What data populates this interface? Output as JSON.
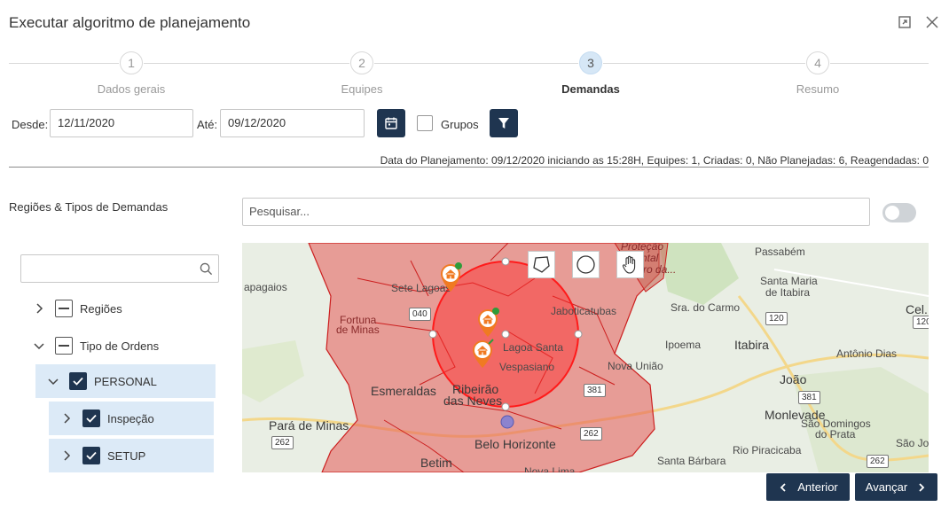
{
  "dialog": {
    "title": "Executar algoritmo de planejamento"
  },
  "stepper": {
    "steps": [
      {
        "number": "1",
        "label": "Dados gerais"
      },
      {
        "number": "2",
        "label": "Equipes"
      },
      {
        "number": "3",
        "label": "Demandas"
      },
      {
        "number": "4",
        "label": "Resumo"
      }
    ],
    "active_index": 2
  },
  "filters": {
    "from_label": "Desde:",
    "from_value": "12/11/2020",
    "to_label": "Até:",
    "to_value": "09/12/2020",
    "groups_label": "Grupos"
  },
  "summary": "Data do Planejamento: 09/12/2020 iniciando as 15:28H, Equipes: 1, Criadas: 0, Não Planejadas: 6, Reagendadas: 0",
  "regions": {
    "title": "Regiões & Tipos de Demandas"
  },
  "search": {
    "placeholder": "Pesquisar..."
  },
  "tree": {
    "items": [
      {
        "label": "Regiões",
        "state": "partial",
        "expanded": false
      },
      {
        "label": "Tipo de Ordens",
        "state": "partial",
        "expanded": true
      },
      {
        "label": "PERSONAL",
        "state": "checked",
        "expanded": true
      },
      {
        "label": "Inspeção",
        "state": "checked",
        "expanded": false
      },
      {
        "label": "SETUP",
        "state": "checked",
        "expanded": false
      }
    ]
  },
  "map": {
    "labels": {
      "passabem": "Passabém",
      "santa_maria": "Santa Maria",
      "de_itabira": "de Itabira",
      "papagaios": "apagaios",
      "sete_lagoas": "Sete Lagoas",
      "jaboticatubas": "Jaboticatubas",
      "sra_do_carmo": "Sra. do Carmo",
      "fortuna": "Fortuna",
      "de_minas": "de Minas",
      "lagoa_santa": "Lagoa Santa",
      "ipoema": "Ipoema",
      "itabira": "Itabira",
      "cel": "Cel.",
      "vespasiano": "Vespasiano",
      "antonio_dias": "Antônio Dias",
      "nova_uniao": "Nova União",
      "esmeraldas": "Esmeraldas",
      "ribeirao": "Ribeirão",
      "das_neves": "das Neves",
      "joao": "João",
      "monlevade": "Monlevade",
      "para_de_minas": "Pará de Minas",
      "sao_domingos": "São Domingos",
      "do_prata": "do Prata",
      "belo_horizonte": "Belo Horizonte",
      "sao_jo": "São Jo",
      "betim": "Betim",
      "santa_barbara": "Santa Bárbara",
      "rio_piracicaba": "Rio Piracicaba",
      "nova_lima": "Nova Lima",
      "protecao_1": "Proteção",
      "protecao_2": "ntal",
      "protecao_3": "rro da..."
    },
    "roads": {
      "r040": "040",
      "r120a": "120",
      "r120b": "120",
      "r381a": "381",
      "r381b": "381",
      "r262a": "262",
      "r262b": "262",
      "r262c": "262"
    },
    "tools": [
      "polygon-tool",
      "circle-tool",
      "pan-tool"
    ],
    "colors": {
      "region": "#e55a55",
      "selection": "#ff2a2a",
      "marker": "#f07a22"
    }
  },
  "nav": {
    "back": "Anterior",
    "next": "Avançar"
  }
}
